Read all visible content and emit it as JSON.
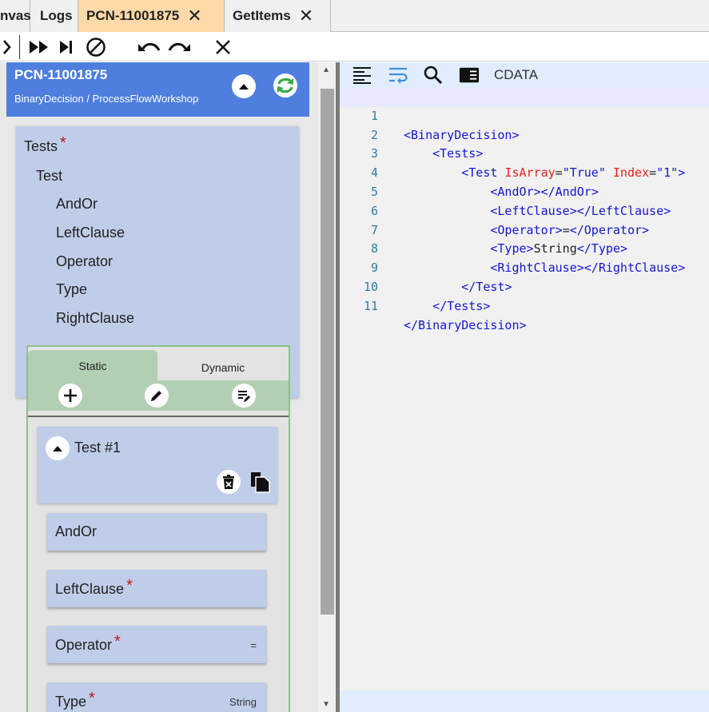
{
  "tabs": [
    {
      "label": "nvas",
      "closable": false,
      "active": false
    },
    {
      "label": "Logs",
      "closable": false,
      "active": false
    },
    {
      "label": "PCN-11001875",
      "closable": true,
      "active": true
    },
    {
      "label": "GetItems",
      "closable": true,
      "active": false
    }
  ],
  "tab_close_glyph": "✕",
  "toolbar": {
    "icons": [
      "chevron-right-icon",
      "fast-forward-icon",
      "skip-next-icon",
      "cancel-icon",
      "undo-icon",
      "redo-icon",
      "close-icon"
    ]
  },
  "header": {
    "title": "PCN-11001875",
    "subtitle": "BinaryDecision / ProcessFlowWorkshop",
    "bg_color": "#4e7fde"
  },
  "tree": {
    "root": "Tests",
    "child": "Test",
    "leaves": [
      "AndOr",
      "LeftClause",
      "Operator",
      "Type",
      "RightClause"
    ],
    "required_marker": "*"
  },
  "editor_panel": {
    "tabs": [
      "Static",
      "Dynamic"
    ],
    "actions": [
      "add-icon",
      "edit-icon",
      "edit-list-icon"
    ],
    "test_title": "Test #1",
    "fields": [
      {
        "label": "AndOr",
        "required": false,
        "value": ""
      },
      {
        "label": "LeftClause",
        "required": true,
        "value": ""
      },
      {
        "label": "Operator",
        "required": true,
        "value": "="
      },
      {
        "label": "Type",
        "required": true,
        "value": "String"
      }
    ]
  },
  "code_editor": {
    "toolbar_label": "CDATA",
    "icons": [
      "format-align-icon",
      "wrap-text-icon",
      "search-icon",
      "side-panel-icon"
    ],
    "line_numbers": [
      "1",
      "2",
      "3",
      "4",
      "5",
      "6",
      "7",
      "8",
      "9",
      "10",
      "11"
    ],
    "lines": [
      "<BinaryDecision>",
      "    <Tests>",
      "        <Test IsArray=\"True\" Index=\"1\">",
      "            <AndOr></AndOr>",
      "            <LeftClause></LeftClause>",
      "            <Operator>=</Operator>",
      "            <Type>String</Type>",
      "            <RightClause></RightClause>",
      "        </Test>",
      "    </Tests>",
      "</BinaryDecision>"
    ]
  },
  "colors": {
    "active_tab": "#ffd9a8",
    "card": "#c0cde8",
    "green_tab": "#b2cfb3",
    "required": "#c0141b",
    "xml_tag": "#1515d0",
    "xml_attr": "#e2231a"
  }
}
